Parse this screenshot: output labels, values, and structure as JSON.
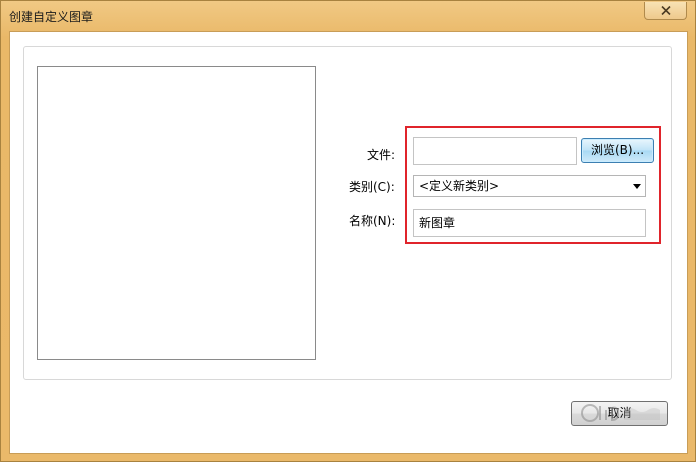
{
  "window": {
    "title": "创建自定义图章"
  },
  "form": {
    "file_label": "文件:",
    "file_value": "",
    "browse_label": "浏览(B)...",
    "category_label": "类别(C):",
    "category_selected": "<定义新类别>",
    "name_label": "名称(N):",
    "name_value": "新图章"
  },
  "footer": {
    "cancel_label": "取消"
  },
  "icons": {
    "close": "close-icon",
    "dropdown": "chevron-down-icon"
  },
  "colors": {
    "highlight_frame": "#e0242b",
    "title_bar": "#eab96a",
    "browse_button": "#bfe3f7"
  }
}
